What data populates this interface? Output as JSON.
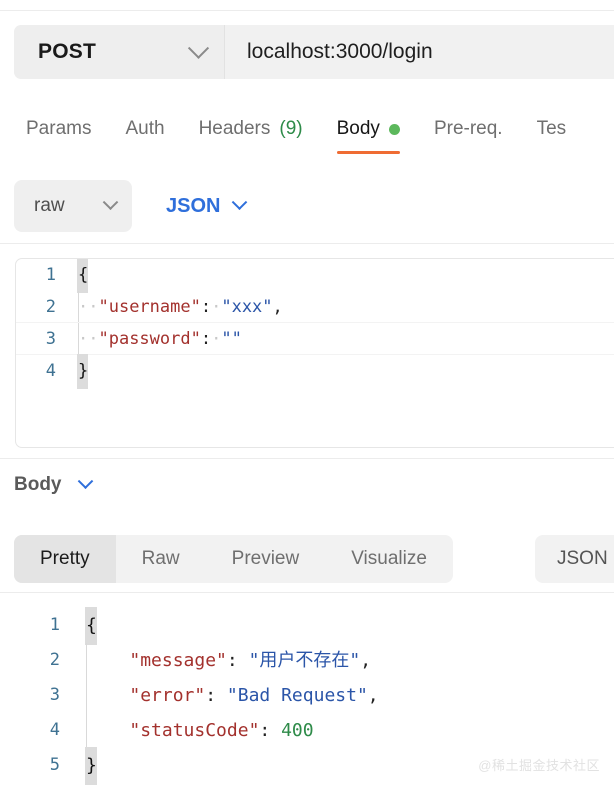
{
  "request": {
    "method": "POST",
    "url": "localhost:3000/login",
    "tabs": [
      {
        "label": "Params",
        "active": false,
        "badge": "",
        "dot": false
      },
      {
        "label": "Auth",
        "active": false,
        "badge": "",
        "dot": false
      },
      {
        "label": "Headers",
        "active": false,
        "badge": "(9)",
        "dot": false
      },
      {
        "label": "Body",
        "active": true,
        "badge": "",
        "dot": true
      },
      {
        "label": "Pre-req.",
        "active": false,
        "badge": "",
        "dot": false
      },
      {
        "label": "Tes",
        "active": false,
        "badge": "",
        "dot": false
      }
    ],
    "body_mode": "raw",
    "body_format": "JSON",
    "editor": {
      "lines": [
        {
          "num": "1",
          "tokens": [
            {
              "t": "{",
              "c": "brace"
            }
          ]
        },
        {
          "num": "2",
          "tokens": [
            {
              "t": "··",
              "c": "ws"
            },
            {
              "t": "\"username\"",
              "c": "k"
            },
            {
              "t": ":",
              "c": "p"
            },
            {
              "t": "·",
              "c": "ws"
            },
            {
              "t": "\"xxx\"",
              "c": "s"
            },
            {
              "t": ",",
              "c": "p"
            }
          ]
        },
        {
          "num": "3",
          "tokens": [
            {
              "t": "··",
              "c": "ws"
            },
            {
              "t": "\"password\"",
              "c": "k"
            },
            {
              "t": ":",
              "c": "p"
            },
            {
              "t": "·",
              "c": "ws"
            },
            {
              "t": "\"\"",
              "c": "s"
            }
          ]
        },
        {
          "num": "4",
          "tokens": [
            {
              "t": "}",
              "c": "brace"
            }
          ]
        }
      ]
    }
  },
  "response": {
    "section_label": "Body",
    "tabs": [
      {
        "label": "Pretty",
        "active": true
      },
      {
        "label": "Raw",
        "active": false
      },
      {
        "label": "Preview",
        "active": false
      },
      {
        "label": "Visualize",
        "active": false
      }
    ],
    "format": "JSON",
    "editor": {
      "lines": [
        {
          "num": "1",
          "tokens": [
            {
              "t": "{",
              "c": "brace"
            }
          ]
        },
        {
          "num": "2",
          "tokens": [
            {
              "t": "    ",
              "c": "ws"
            },
            {
              "t": "\"message\"",
              "c": "k"
            },
            {
              "t": ": ",
              "c": "p"
            },
            {
              "t": "\"用户不存在\"",
              "c": "s"
            },
            {
              "t": ",",
              "c": "p"
            }
          ]
        },
        {
          "num": "3",
          "tokens": [
            {
              "t": "    ",
              "c": "ws"
            },
            {
              "t": "\"error\"",
              "c": "k"
            },
            {
              "t": ": ",
              "c": "p"
            },
            {
              "t": "\"Bad Request\"",
              "c": "s"
            },
            {
              "t": ",",
              "c": "p"
            }
          ]
        },
        {
          "num": "4",
          "tokens": [
            {
              "t": "    ",
              "c": "ws"
            },
            {
              "t": "\"statusCode\"",
              "c": "k"
            },
            {
              "t": ": ",
              "c": "p"
            },
            {
              "t": "400",
              "c": "n"
            }
          ]
        },
        {
          "num": "5",
          "tokens": [
            {
              "t": "}",
              "c": "brace"
            }
          ]
        }
      ]
    }
  },
  "watermark": "@稀土掘金技术社区",
  "colors": {
    "accent_orange": "#ef6c33",
    "status_green": "#5cb85c",
    "link_blue": "#2f6fdb",
    "json_key": "#a3312d",
    "json_string": "#2b55a8",
    "json_number": "#2e8b49",
    "line_number": "#3f7292"
  }
}
